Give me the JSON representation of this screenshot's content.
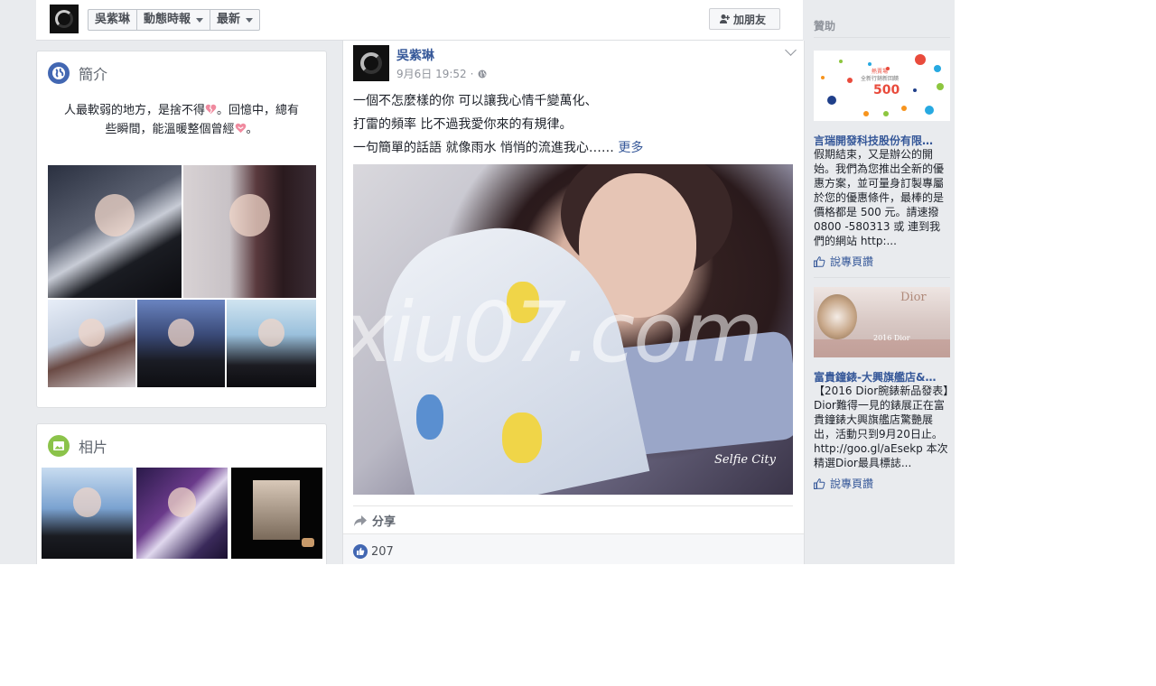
{
  "topbar": {
    "nav": [
      {
        "label": "吳紫琳",
        "caret": false
      },
      {
        "label": "動態時報",
        "caret": true
      },
      {
        "label": "最新",
        "caret": true
      }
    ],
    "add_friend_label": "加朋友"
  },
  "intro": {
    "title": "簡介",
    "text_line1_a": "人最軟弱的地方，是捨不得",
    "text_line1_b": "。回憶中，總有",
    "text_line2_a": "些瞬間，能溫暖整個曾經",
    "text_line2_b": "。"
  },
  "photos": {
    "title": "相片"
  },
  "post": {
    "author": "吳紫琳",
    "timestamp": "9月6日 19:52",
    "meta_sep": "·",
    "lines": [
      "一個不怎麼樣的你 可以讓我心情千變萬化、",
      "打雷的頻率 比不過我愛你來的有規律。",
      "一句簡單的話語 就像雨水 悄悄的流進我心……"
    ],
    "more_label": "更多",
    "photo_signature": "Selfie City",
    "watermark": "xiu07.com",
    "share_label": "分享",
    "like_count": "207"
  },
  "sidebar": {
    "sponsored_label": "贊助",
    "ads": [
      {
        "img_text_top": "熱賣場",
        "img_text_sub": "全新行銷新回饋",
        "img_price": "500",
        "title": "言瑞開發科技股份有限…",
        "body": "假期結束，又是辦公的開始。我們為您推出全新的優惠方案，並可量身訂製專屬於您的優惠條件，最棒的是價格都是 500 元。請速撥 0800 -580313 或 連到我們的網站 http:...",
        "like_label": "說專頁讚"
      },
      {
        "img_text_top": "Dior",
        "img_text_sub": "2016 Dior",
        "img_price": "",
        "title": "富貴鐘錶-大興旗艦店&…",
        "body": "【2016 Dior腕錶新品發表】Dior難得一見的錶展正在富貴鐘錶大興旗艦店驚艷展出，活動只到9月20日止。http://goo.gl/aEsekp 本次精選Dior最具標誌...",
        "like_label": "說專頁讚"
      }
    ]
  },
  "colors": {
    "link": "#365899",
    "like_blue": "#4267b2",
    "page_bg": "#e9ebee"
  },
  "icons": [
    "globe-icon",
    "photo-icon",
    "add-friend-icon",
    "share-icon",
    "like-icon",
    "thumbs-up-icon",
    "broken-heart-icon",
    "heart-icon",
    "globe-small-icon",
    "chevron-down-icon"
  ]
}
